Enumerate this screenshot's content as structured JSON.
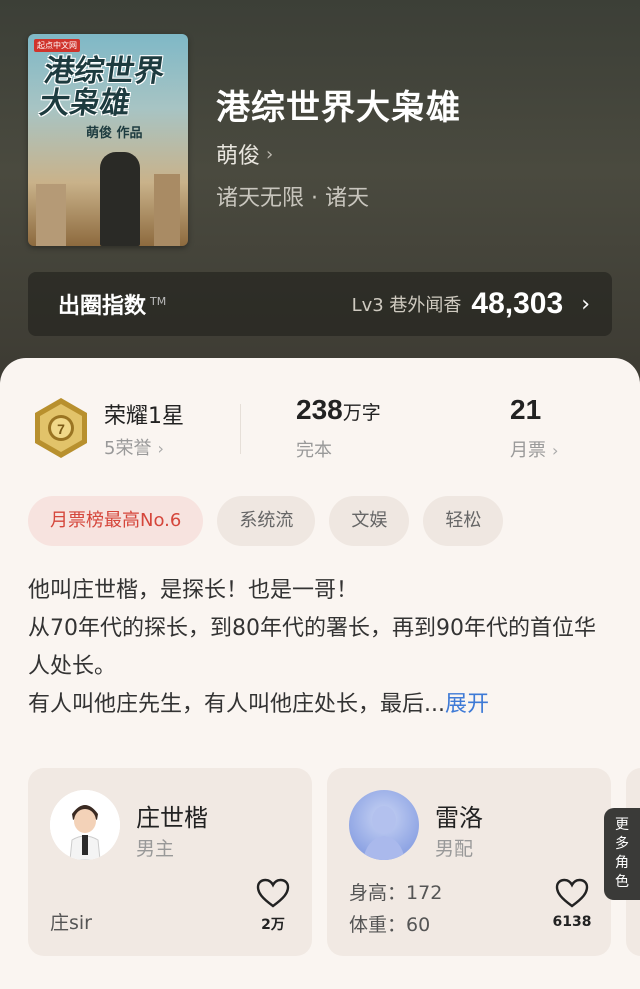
{
  "book": {
    "title": "港综世界大枭雄",
    "author": "萌俊",
    "genre": "诸天无限 · 诸天",
    "cover": {
      "logo": "起点中文网",
      "title_line1": "港综世界",
      "title_line2": "大枭雄",
      "author": "萌俊 作品"
    }
  },
  "index": {
    "label": "出圈指数",
    "tm": "TM",
    "level": "Lv3 巷外闻香",
    "value": "48,303"
  },
  "stats": {
    "honor_title": "荣耀1星",
    "honor_sub": "5荣誉",
    "badge_number": "7",
    "word_count": "238",
    "word_unit": "万字",
    "status": "完本",
    "monthly_tickets": "21",
    "tickets_label": "月票"
  },
  "tags": [
    "月票榜最高No.6",
    "系统流",
    "文娱",
    "轻松"
  ],
  "intro": {
    "line1": "他叫庄世楷，是探长！也是一哥！",
    "line2": "从70年代的探长，到80年代的署长，再到90年代的首位华人处长。",
    "line3": "有人叫他庄先生，有人叫他庄处长，最后...",
    "expand": "展开"
  },
  "roles": [
    {
      "name": "庄世楷",
      "role": "男主",
      "nickname": "庄sir",
      "likes": "2万"
    },
    {
      "name": "雷洛",
      "role": "男配",
      "height_label": "身高：",
      "height": "172",
      "weight_label": "体重：",
      "weight": "60",
      "likes": "6138"
    }
  ],
  "more_roles": "更多角色",
  "colors": {
    "accent_blue": "#3e7ad6",
    "hot_tag_red": "#d5463b",
    "badge_gold": "#c9a13b"
  },
  "icons": [
    "chevron-right-icon",
    "heart-icon",
    "honor-badge-icon"
  ]
}
